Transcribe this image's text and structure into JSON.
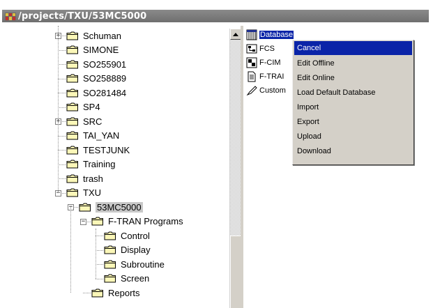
{
  "window": {
    "title": "/projects/TXU/53MC5000",
    "title_icon": "grid-app-icon"
  },
  "tree": {
    "items": [
      {
        "label": "Schuman",
        "expander": "+"
      },
      {
        "label": "SIMONE"
      },
      {
        "label": "SO255901"
      },
      {
        "label": "SO258889"
      },
      {
        "label": "SO281484"
      },
      {
        "label": "SP4"
      },
      {
        "label": "SRC",
        "expander": "+"
      },
      {
        "label": "TAI_YAN"
      },
      {
        "label": "TESTJUNK"
      },
      {
        "label": "Training"
      },
      {
        "label": "trash"
      },
      {
        "label": "TXU",
        "expander": "−"
      },
      {
        "label": "53MC5000",
        "expander": "−",
        "selected": true
      },
      {
        "label": "F-TRAN Programs",
        "expander": "−"
      },
      {
        "label": "Control"
      },
      {
        "label": "Display"
      },
      {
        "label": "Subroutine"
      },
      {
        "label": "Screen"
      },
      {
        "label": "Reports"
      }
    ]
  },
  "list": {
    "items": [
      {
        "label": "Database",
        "icon": "database-icon",
        "selected": true
      },
      {
        "label": "FCS",
        "icon": "fcs-icon"
      },
      {
        "label": "F-CIM",
        "icon": "fcim-icon"
      },
      {
        "label": "F-TRAI",
        "icon": "document-icon"
      },
      {
        "label": "Custom",
        "icon": "pen-icon"
      }
    ]
  },
  "context_menu": {
    "items": [
      {
        "label": "Cancel",
        "highlighted": true
      },
      {
        "label": "Edit Offline"
      },
      {
        "label": "Edit Online"
      },
      {
        "label": "Load Default Database"
      },
      {
        "label": "Import"
      },
      {
        "label": "Export"
      },
      {
        "label": "Upload"
      },
      {
        "label": "Download"
      }
    ]
  },
  "colors": {
    "selection": "#0a24a8",
    "folder": "#f5f0a0",
    "menu_bg": "#d4d0c8"
  }
}
